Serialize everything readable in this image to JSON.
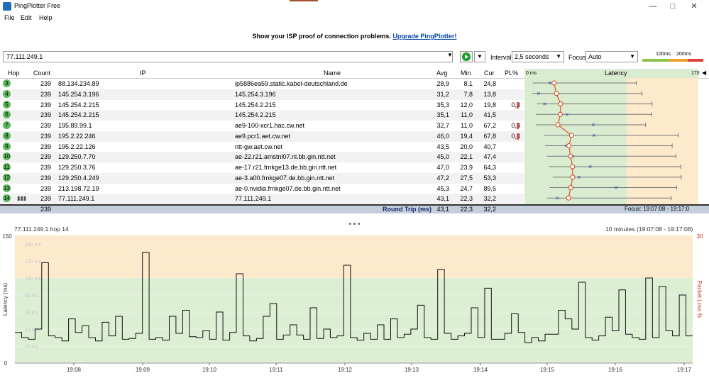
{
  "window": {
    "title": "PingPlotter Free",
    "minimize": "—",
    "maximize": "□",
    "close": "✕"
  },
  "menu": [
    "File",
    "Edit",
    "Help"
  ],
  "promo": {
    "text": "Show your ISP proof of connection problems.",
    "link": "Upgrade PingPlotter!"
  },
  "toolbar": {
    "target": "77.111.249.1",
    "interval_label": "Interval",
    "interval_value": "2,5 seconds",
    "focus_label": "Focus",
    "focus_value": "Auto",
    "scale_100": "100ms",
    "scale_200": "200ms"
  },
  "table": {
    "headers": {
      "hop": "Hop",
      "count": "Count",
      "ip": "IP",
      "name": "Name",
      "avg": "Avg",
      "min": "Min",
      "cur": "Cur",
      "pl": "PL%",
      "latency": "Latency",
      "lat_start": "0 ms",
      "lat_end": "170"
    },
    "rows": [
      {
        "hop": "3",
        "count": "239",
        "ip": "88.134.234.89",
        "name": "ip5886ea59.static.kabel-deutschland.de",
        "avg": "28,9",
        "min": "8,1",
        "cur": "24,8",
        "pl": ""
      },
      {
        "hop": "4",
        "count": "239",
        "ip": "145.254.3.196",
        "name": "145.254.3.196",
        "avg": "31,2",
        "min": "7,8",
        "cur": "13,8",
        "pl": ""
      },
      {
        "hop": "5",
        "count": "239",
        "ip": "145.254.2.215",
        "name": "145.254.2.215",
        "avg": "35,3",
        "min": "12,0",
        "cur": "19,8",
        "pl": "0,4"
      },
      {
        "hop": "6",
        "count": "239",
        "ip": "145.254.2.215",
        "name": "145.254.2.215",
        "avg": "35,1",
        "min": "11,0",
        "cur": "41,5",
        "pl": ""
      },
      {
        "hop": "7",
        "count": "239",
        "ip": "195.89.99.1",
        "name": "ae9-100-xcr1.hac.cw.net",
        "avg": "32,7",
        "min": "11,0",
        "cur": "67,2",
        "pl": "0,4"
      },
      {
        "hop": "8",
        "count": "239",
        "ip": "195.2.22.246",
        "name": "ae9.pcr1.aet.cw.net",
        "avg": "46,0",
        "min": "19,4",
        "cur": "67,8",
        "pl": "0,4"
      },
      {
        "hop": "9",
        "count": "239",
        "ip": "195.2.22.126",
        "name": "ntt-gw.aet.cw.net",
        "avg": "43,5",
        "min": "20,0",
        "cur": "40,7",
        "pl": ""
      },
      {
        "hop": "10",
        "count": "239",
        "ip": "129.250.7.70",
        "name": "ae-22.r21.amstnl07.nl.bb.gin.ntt.net",
        "avg": "45,0",
        "min": "22,1",
        "cur": "47,4",
        "pl": ""
      },
      {
        "hop": "11",
        "count": "239",
        "ip": "129.250.3.76",
        "name": "ae-17.r21.frnkge13.de.bb.gin.ntt.net",
        "avg": "47,0",
        "min": "23,9",
        "cur": "64,3",
        "pl": ""
      },
      {
        "hop": "12",
        "count": "239",
        "ip": "129.250.4.249",
        "name": "ae-3.a00.frnkge07.de.bb.gin.ntt.net",
        "avg": "47,2",
        "min": "27,5",
        "cur": "53,3",
        "pl": ""
      },
      {
        "hop": "13",
        "count": "239",
        "ip": "213.198.72.19",
        "name": "ae-0.nvidia.frnkge07.de.bb.gin.ntt.net",
        "avg": "45,3",
        "min": "24,7",
        "cur": "89,5",
        "pl": ""
      },
      {
        "hop": "14",
        "count": "239",
        "ip": "77.111.249.1",
        "name": "77.111.249.1",
        "avg": "43,1",
        "min": "22,3",
        "cur": "32,2",
        "pl": ""
      }
    ],
    "summary": {
      "count": "239",
      "label": "Round Trip (ms)",
      "avg": "43,1",
      "min": "22,3",
      "cur": "32,2",
      "focus": "Focus: 19:07:08 - 19:17:0"
    }
  },
  "graph": {
    "title": "77.111.249.1 hop 14",
    "range": "10 minutes (19:07:08 - 19:17:08)",
    "y_label": "Latency (ms)",
    "y2_label": "Packet Loss %",
    "y_top": "150",
    "y_zero": "0",
    "y2_top": "30",
    "band_labels": [
      "140 ms",
      "120 ms",
      "100 ms",
      "80 ms",
      "60 ms",
      "40 ms",
      "20 ms"
    ],
    "x_labels": [
      "19:08",
      "19:09",
      "19:10",
      "19:11",
      "19:12",
      "19:13",
      "19:14",
      "19:15",
      "19:16",
      "19:17"
    ]
  },
  "chart_data": {
    "type": "line",
    "title": "77.111.249.1 hop 14",
    "ylabel": "Latency (ms)",
    "ylim": [
      0,
      150
    ],
    "x": [
      "19:08",
      "19:09",
      "19:10",
      "19:11",
      "19:12",
      "19:13",
      "19:14",
      "19:15",
      "19:16",
      "19:17"
    ],
    "series": [
      {
        "values": [
          36,
          30,
          28,
          40,
          118,
          32,
          30,
          26,
          52,
          36,
          44,
          30,
          26,
          48,
          32,
          55,
          28,
          29,
          35,
          130,
          28,
          30,
          27,
          55,
          35,
          62,
          31,
          30,
          38,
          28,
          60,
          27,
          36,
          105,
          32,
          26,
          29,
          55,
          70,
          28,
          33,
          45,
          33,
          28,
          65,
          29,
          40,
          30,
          32,
          115,
          30,
          27,
          35,
          28,
          45,
          28,
          52,
          30,
          34,
          40,
          68,
          30,
          28,
          110,
          35,
          28,
          32,
          35,
          65,
          30,
          88,
          28,
          28,
          35,
          58,
          36,
          24,
          30,
          26,
          34,
          34,
          62,
          52,
          40,
          95,
          30,
          27,
          32,
          54,
          38,
          86,
          34,
          30,
          28,
          100,
          30,
          90,
          38,
          32,
          80,
          32
        ]
      }
    ]
  }
}
